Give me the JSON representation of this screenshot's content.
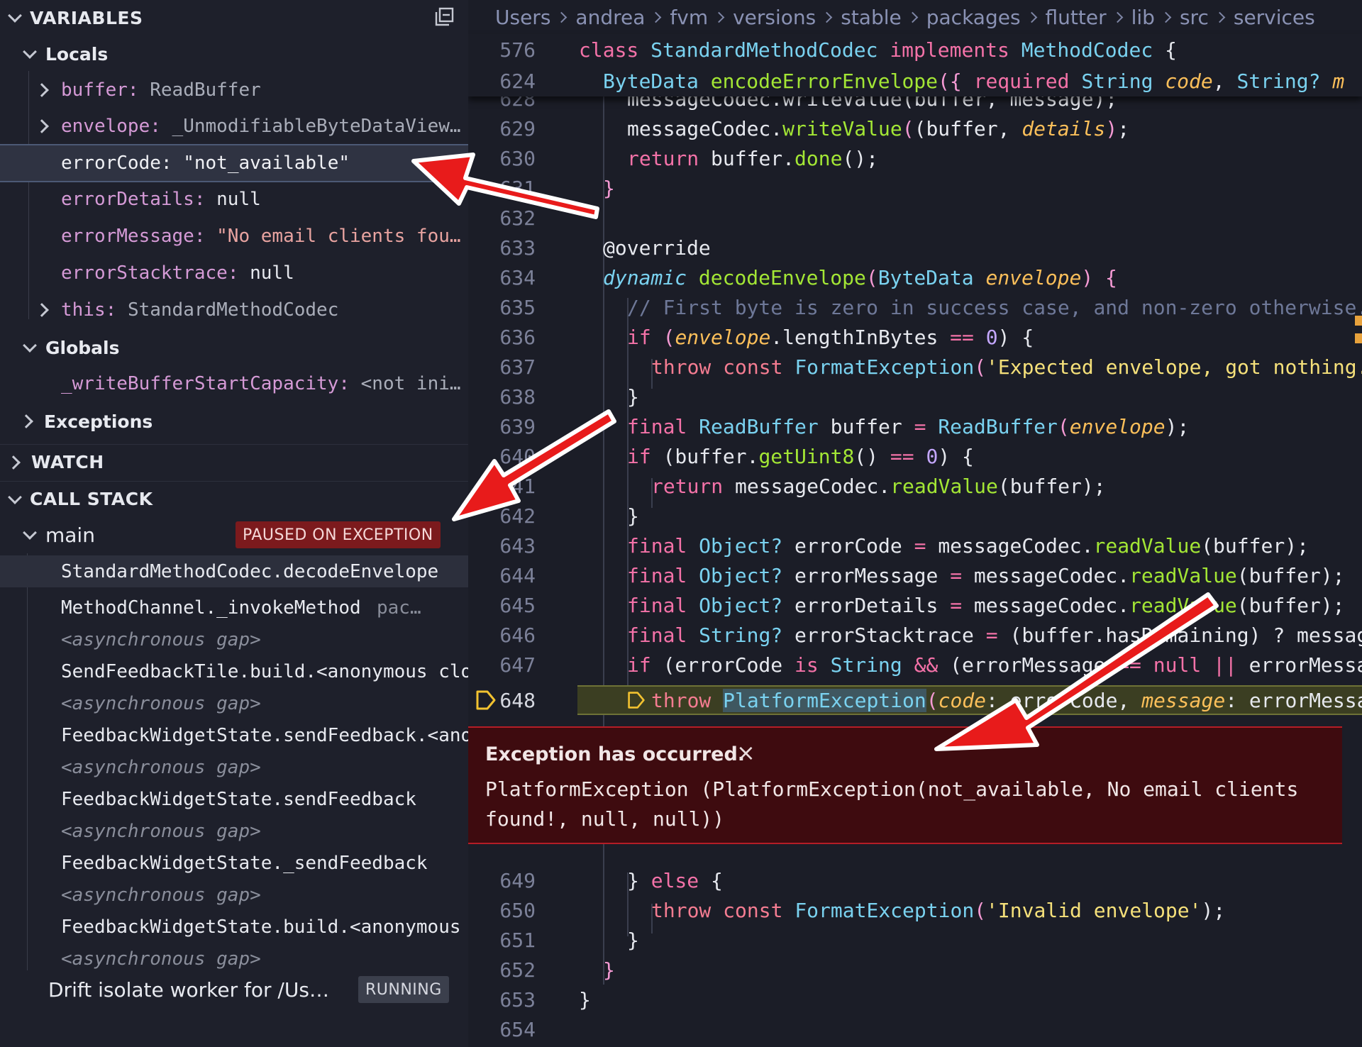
{
  "sidebar": {
    "variables_header": "VARIABLES",
    "locals_label": "Locals",
    "locals": [
      {
        "name": "buffer",
        "value": "ReadBuffer",
        "expandable": true
      },
      {
        "name": "envelope",
        "value": "_UnmodifiableByteDataView…",
        "expandable": true
      },
      {
        "name": "errorCode",
        "value": "\"not_available\"",
        "expandable": false,
        "selected": true
      },
      {
        "name": "errorDetails",
        "value": "null",
        "expandable": false
      },
      {
        "name": "errorMessage",
        "value": "\"No email clients fou…",
        "expandable": false
      },
      {
        "name": "errorStacktrace",
        "value": "null",
        "expandable": false
      },
      {
        "name": "this",
        "value": "StandardMethodCodec",
        "expandable": true
      }
    ],
    "globals_label": "Globals",
    "globals": [
      {
        "name": "_writeBufferStartCapacity",
        "value": "<not ini…"
      }
    ],
    "exceptions_label": "Exceptions",
    "watch_header": "WATCH",
    "callstack_header": "CALL STACK",
    "threads": [
      {
        "name": "main",
        "status": "PAUSED ON EXCEPTION"
      },
      {
        "name": "Drift isolate worker for /Us…",
        "status": "RUNNING"
      }
    ],
    "frames": [
      {
        "label": "StandardMethodCodec.decodeEnvelope",
        "async": false,
        "active": true,
        "source": ""
      },
      {
        "label": "MethodChannel._invokeMethod",
        "async": false,
        "source": "pac…"
      },
      {
        "label": "<asynchronous gap>",
        "async": true,
        "source": ""
      },
      {
        "label": "SendFeedbackTile.build.<anonymous clo",
        "async": false,
        "source": ""
      },
      {
        "label": "<asynchronous gap>",
        "async": true,
        "source": ""
      },
      {
        "label": "FeedbackWidgetState.sendFeedback.<ano",
        "async": false,
        "source": ""
      },
      {
        "label": "<asynchronous gap>",
        "async": true,
        "source": ""
      },
      {
        "label": "FeedbackWidgetState.sendFeedback",
        "async": false,
        "source": ""
      },
      {
        "label": "<asynchronous gap>",
        "async": true,
        "source": ""
      },
      {
        "label": "FeedbackWidgetState._sendFeedback",
        "async": false,
        "source": ""
      },
      {
        "label": "<asynchronous gap>",
        "async": true,
        "source": ""
      },
      {
        "label": "FeedbackWidgetState.build.<anonymous",
        "async": false,
        "source": ""
      },
      {
        "label": "<asynchronous gap>",
        "async": true,
        "source": ""
      }
    ]
  },
  "breadcrumbs": [
    "Users",
    "andrea",
    "fvm",
    "versions",
    "stable",
    "packages",
    "flutter",
    "lib",
    "src",
    "services"
  ],
  "sticky": [
    {
      "ln": "576"
    },
    {
      "ln": "624"
    }
  ],
  "lines": [
    {
      "ln": "628"
    },
    {
      "ln": "629"
    },
    {
      "ln": "630"
    },
    {
      "ln": "631"
    },
    {
      "ln": "632"
    },
    {
      "ln": "633"
    },
    {
      "ln": "634"
    },
    {
      "ln": "635"
    },
    {
      "ln": "636"
    },
    {
      "ln": "637"
    },
    {
      "ln": "638"
    },
    {
      "ln": "639"
    },
    {
      "ln": "640"
    },
    {
      "ln": "641"
    },
    {
      "ln": "642"
    },
    {
      "ln": "643"
    },
    {
      "ln": "644"
    },
    {
      "ln": "645"
    },
    {
      "ln": "646"
    },
    {
      "ln": "647"
    },
    {
      "ln": "648"
    },
    {
      "ln": "649"
    },
    {
      "ln": "650"
    },
    {
      "ln": "651"
    },
    {
      "ln": "652"
    },
    {
      "ln": "653"
    },
    {
      "ln": "654"
    }
  ],
  "code": {
    "class_kw": "class",
    "class_name": "StandardMethodCodec",
    "implements_kw": "implements",
    "iface": "MethodCodec",
    "open": " {",
    "s2_ret": "ByteData",
    "s2_fn": "encodeErrorEnvelope",
    "s2_a": "({ ",
    "s2_req": "required",
    "s2_t1": "String",
    "s2_p1": "code",
    "s2_c": ", ",
    "s2_t2": "String?",
    "s2_more": " m",
    "l628": "messageCodec.writeValue(buffer, message);",
    "l629_obj": "messageCodec.",
    "l629_fn": "writeValue",
    "l629_a": "(buffer, ",
    "l629_p": "details",
    "l629_b": ");",
    "l630_kw": "return",
    "l630_rest": " buffer.",
    "l630_fn": "done",
    "l630_end": "();",
    "close_brace": "}",
    "l633": "@override",
    "l634_dyn": "dynamic",
    "l634_fn": "decodeEnvelope",
    "l634_ty": "ByteData",
    "l634_p": "envelope",
    "l634_end": ") {",
    "l635": "// First byte is zero in success case, and non-zero otherwise.",
    "l636_kw": "if",
    "l636_p": "envelope",
    "l636_rest": ".lengthInBytes ",
    "l636_op": "==",
    "l636_n": "0",
    "l636_end": ") {",
    "l637_kw1": "throw",
    "l637_kw2": "const",
    "l637_ty": "FormatException",
    "l637_str": "'Expected envelope, got nothing.'",
    "l639_kw": "final",
    "l639_ty": "ReadBuffer",
    "l639_var": " buffer ",
    "l639_op": "=",
    "l639_ctor": "ReadBuffer",
    "l639_p": "envelope",
    "l639_end": ");",
    "l640_kw": "if",
    "l640_a": " (buffer.",
    "l640_fn": "getUint8",
    "l640_b": "() ",
    "l640_op": "==",
    "l640_n": "0",
    "l640_end": ") {",
    "l641_kw": "return",
    "l641_a": " messageCodec.",
    "l641_fn": "readValue",
    "l641_b": "(buffer);",
    "l643_kw": "final",
    "l643_ty": "Object?",
    "l643_var": " errorCode ",
    "l643_op": "=",
    "l643_a": " messageCodec.",
    "l643_fn": "readValue",
    "l643_b": "(buffer);",
    "l644_var": " errorMessage ",
    "l645_var": " errorDetails ",
    "l646_ty": "String?",
    "l646_var": " errorStacktrace ",
    "l646_rest": " (buffer.hasRemaining) ? messageCodec.readValue(buffer) as String? : null;",
    "l647_kw": "if",
    "l647_a": " (errorCode ",
    "l647_is": "is",
    "l647_ty": "String",
    "l647_and": "&&",
    "l647_b": " (errorMessage ",
    "l647_c": "null",
    "l647_or": "||",
    "l647_d": " errorMessage is String)) {",
    "l648_kw": "throw",
    "l648_ty": "PlatformException",
    "l648_p1": "code",
    "l648_a": ": errorCode, ",
    "l648_p2": "message",
    "l648_b": ": errorMessage, details: errorDetails, stacktrace: errorStacktrace);",
    "l649_close": "} ",
    "l649_else": "else",
    "l649_open": " {",
    "l650_str": "'Invalid envelope'",
    "l650_end": ");"
  },
  "exception": {
    "title": "Exception has occurred.",
    "close": "×",
    "message": "PlatformException (PlatformException(not_available, No email clients found!, null, null))"
  },
  "colors": {
    "annotation_arrow": "#e81b1b",
    "paused_badge": "#7c1a1d",
    "exception_bg": "#3e0b0f"
  },
  "icons": [
    "collapse-all-icon",
    "chevron-down-icon",
    "chevron-right-icon",
    "breakpoint-paused-icon",
    "close-icon"
  ]
}
